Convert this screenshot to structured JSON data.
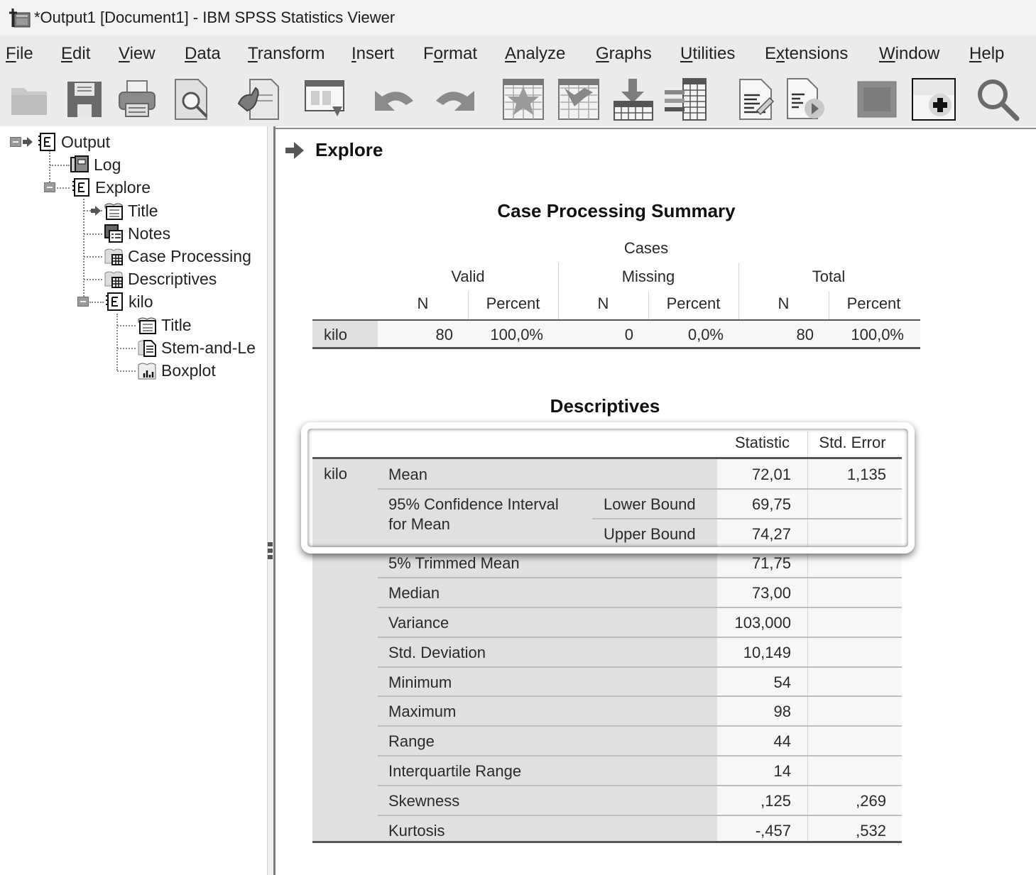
{
  "window": {
    "title": "*Output1 [Document1] - IBM SPSS Statistics Viewer",
    "app_icon": "spss-viewer-icon"
  },
  "menubar": {
    "items": [
      {
        "label": "File",
        "mnemonic": "F"
      },
      {
        "label": "Edit",
        "mnemonic": "E"
      },
      {
        "label": "View",
        "mnemonic": "V"
      },
      {
        "label": "Data",
        "mnemonic": "D"
      },
      {
        "label": "Transform",
        "mnemonic": "T"
      },
      {
        "label": "Insert",
        "mnemonic": "I"
      },
      {
        "label": "Format",
        "mnemonic": "o"
      },
      {
        "label": "Analyze",
        "mnemonic": "A"
      },
      {
        "label": "Graphs",
        "mnemonic": "G"
      },
      {
        "label": "Utilities",
        "mnemonic": "U"
      },
      {
        "label": "Extensions",
        "mnemonic": "x"
      },
      {
        "label": "Window",
        "mnemonic": "W"
      },
      {
        "label": "Help",
        "mnemonic": "H"
      }
    ]
  },
  "toolbar": {
    "buttons": [
      {
        "name": "open",
        "icon": "folder-icon"
      },
      {
        "name": "save",
        "icon": "floppy-disk-icon"
      },
      {
        "name": "print",
        "icon": "printer-icon"
      },
      {
        "name": "print-preview",
        "icon": "print-preview-icon"
      },
      {
        "name": "export",
        "icon": "export-document-icon"
      },
      {
        "name": "recall-dialog",
        "icon": "recall-dialog-icon"
      },
      {
        "name": "undo",
        "icon": "undo-arrow-icon"
      },
      {
        "name": "redo",
        "icon": "redo-arrow-icon"
      },
      {
        "name": "goto-data",
        "icon": "goto-data-icon"
      },
      {
        "name": "goto-case",
        "icon": "goto-case-icon"
      },
      {
        "name": "goto-variable",
        "icon": "goto-variable-icon"
      },
      {
        "name": "variables",
        "icon": "variables-icon"
      },
      {
        "name": "insert-text",
        "icon": "edit-document-icon"
      },
      {
        "name": "run-script",
        "icon": "run-document-icon"
      },
      {
        "name": "designate-window",
        "icon": "designate-window-icon"
      },
      {
        "name": "create-new-output",
        "icon": "add-output-icon"
      },
      {
        "name": "search",
        "icon": "magnifier-icon"
      }
    ]
  },
  "outline": {
    "items": [
      {
        "label": "Output",
        "icon": "output-book-icon",
        "expanded": true,
        "current": true
      },
      {
        "label": "Log",
        "icon": "log-icon"
      },
      {
        "label": "Explore",
        "icon": "procedure-book-icon",
        "expanded": true
      },
      {
        "label": "Title",
        "icon": "title-icon",
        "current": true
      },
      {
        "label": "Notes",
        "icon": "notes-icon"
      },
      {
        "label": "Case Processing",
        "icon": "pivot-table-icon"
      },
      {
        "label": "Descriptives",
        "icon": "pivot-table-icon"
      },
      {
        "label": "kilo",
        "icon": "procedure-book-icon",
        "expanded": true
      },
      {
        "label": "Title",
        "icon": "title-icon"
      },
      {
        "label": "Stem-and-Le",
        "icon": "text-output-icon"
      },
      {
        "label": "Boxplot",
        "icon": "chart-icon"
      }
    ]
  },
  "output": {
    "heading": "Explore",
    "case_processing": {
      "title": "Case Processing Summary",
      "super_header": "Cases",
      "groups": [
        "Valid",
        "Missing",
        "Total"
      ],
      "sub_headers": [
        "N",
        "Percent",
        "N",
        "Percent",
        "N",
        "Percent"
      ],
      "rows": [
        {
          "label": "kilo",
          "values": [
            "80",
            "100,0%",
            "0",
            "0,0%",
            "80",
            "100,0%"
          ]
        }
      ]
    },
    "descriptives": {
      "title": "Descriptives",
      "col_headers": [
        "Statistic",
        "Std. Error"
      ],
      "variable": "kilo",
      "ci_label_line1": "95% Confidence Interval",
      "ci_label_line2": "for Mean",
      "rows": [
        {
          "label": "Mean",
          "sub": "",
          "statistic": "72,01",
          "std_error": "1,135"
        },
        {
          "label": "",
          "sub": "Lower Bound",
          "statistic": "69,75",
          "std_error": ""
        },
        {
          "label": "",
          "sub": "Upper Bound",
          "statistic": "74,27",
          "std_error": ""
        },
        {
          "label": "5% Trimmed Mean",
          "sub": "",
          "statistic": "71,75",
          "std_error": ""
        },
        {
          "label": "Median",
          "sub": "",
          "statistic": "73,00",
          "std_error": ""
        },
        {
          "label": "Variance",
          "sub": "",
          "statistic": "103,000",
          "std_error": ""
        },
        {
          "label": "Std. Deviation",
          "sub": "",
          "statistic": "10,149",
          "std_error": ""
        },
        {
          "label": "Minimum",
          "sub": "",
          "statistic": "54",
          "std_error": ""
        },
        {
          "label": "Maximum",
          "sub": "",
          "statistic": "98",
          "std_error": ""
        },
        {
          "label": "Range",
          "sub": "",
          "statistic": "44",
          "std_error": ""
        },
        {
          "label": "Interquartile Range",
          "sub": "",
          "statistic": "14",
          "std_error": ""
        },
        {
          "label": "Skewness",
          "sub": "",
          "statistic": ",125",
          "std_error": ",269"
        },
        {
          "label": "Kurtosis",
          "sub": "",
          "statistic": "-,457",
          "std_error": ",532"
        }
      ]
    }
  },
  "colors": {
    "label_cell_bg": "#e0e0e0",
    "data_cell_bg": "#f7f7f7",
    "chrome_bg": "#ebebeb"
  }
}
